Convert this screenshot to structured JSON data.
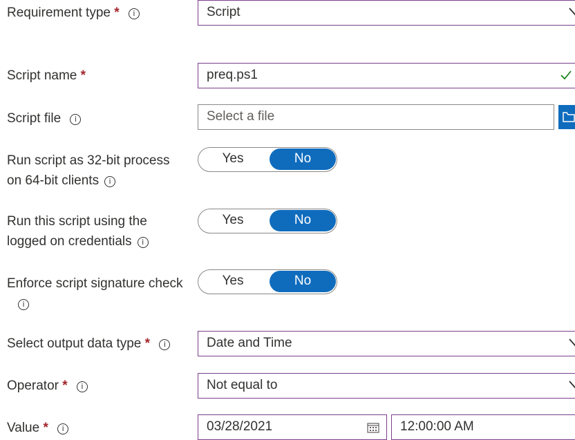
{
  "form": {
    "requirement_type": {
      "label": "Requirement type",
      "required_mark": "*",
      "value": "Script"
    },
    "script_name": {
      "label": "Script name",
      "required_mark": "*",
      "value": "preq.ps1"
    },
    "script_file": {
      "label": "Script file",
      "placeholder": "Select a file"
    },
    "run_32bit": {
      "label_line1": "Run script as 32-bit process",
      "label_line2": "on 64-bit clients",
      "yes": "Yes",
      "no": "No",
      "selected": "No"
    },
    "run_logged_on": {
      "label_line1": "Run this script using the",
      "label_line2": "logged on credentials",
      "yes": "Yes",
      "no": "No",
      "selected": "No"
    },
    "signature_check": {
      "label": "Enforce script signature check",
      "yes": "Yes",
      "no": "No",
      "selected": "No"
    },
    "output_data_type": {
      "label": "Select output data type",
      "required_mark": "*",
      "value": "Date and Time"
    },
    "operator": {
      "label": "Operator",
      "required_mark": "*",
      "value": "Not equal to"
    },
    "value": {
      "label": "Value",
      "required_mark": "*",
      "date": "03/28/2021",
      "time": "12:00:00 AM"
    }
  },
  "icons": {
    "info": "info-icon",
    "chevron": "chevron-down-icon",
    "check": "checkmark-icon",
    "calendar": "calendar-icon",
    "folder": "folder-icon"
  },
  "colors": {
    "accent": "#0f6cbd",
    "focus_border": "#7a3e8c",
    "required": "#a4262c",
    "valid": "#107c10"
  }
}
